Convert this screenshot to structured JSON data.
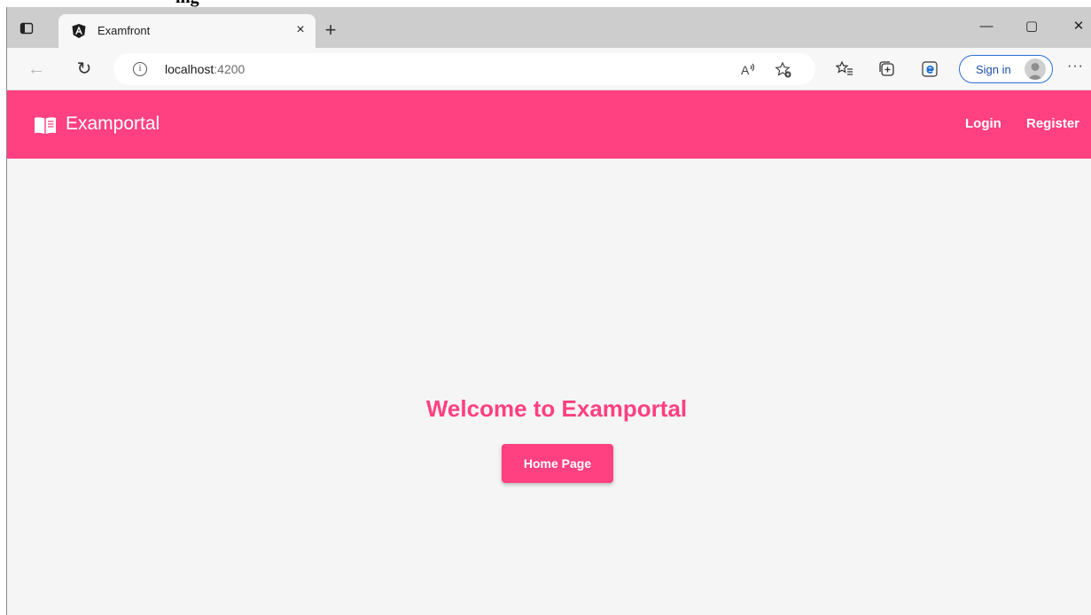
{
  "document": {
    "cropped_heading": "ing"
  },
  "browser": {
    "tab": {
      "title": "Examfront",
      "close_glyph": "×"
    },
    "new_tab_glyph": "+",
    "window_controls": {
      "minimize": "—",
      "maximize": "▢",
      "close": "✕"
    },
    "nav": {
      "back_glyph": "←",
      "refresh_glyph": "↻"
    },
    "address": {
      "host": "localhost",
      "port": ":4200"
    },
    "sign_in_label": "Sign in",
    "more_label": "···"
  },
  "app": {
    "brand": "Examportal",
    "nav_links": {
      "login": "Login",
      "register": "Register"
    },
    "welcome_heading": "Welcome to Examportal",
    "home_button": "Home Page"
  },
  "colors": {
    "accent": "#ff4081",
    "page_background": "#f5f5f5",
    "tab_strip": "#cdcdcd",
    "signin_border": "#2b6fd6"
  },
  "icons": {
    "tab_actions": "tab-actions-icon",
    "favicon": "angular-logo-icon",
    "info": "info-icon",
    "read_aloud": "read-aloud-icon",
    "add_favorite": "add-favorite-icon",
    "favorites": "favorites-icon",
    "collections": "collections-icon",
    "ie_mode": "internet-explorer-mode-icon",
    "profile": "profile-avatar-icon",
    "brand": "open-book-icon"
  }
}
